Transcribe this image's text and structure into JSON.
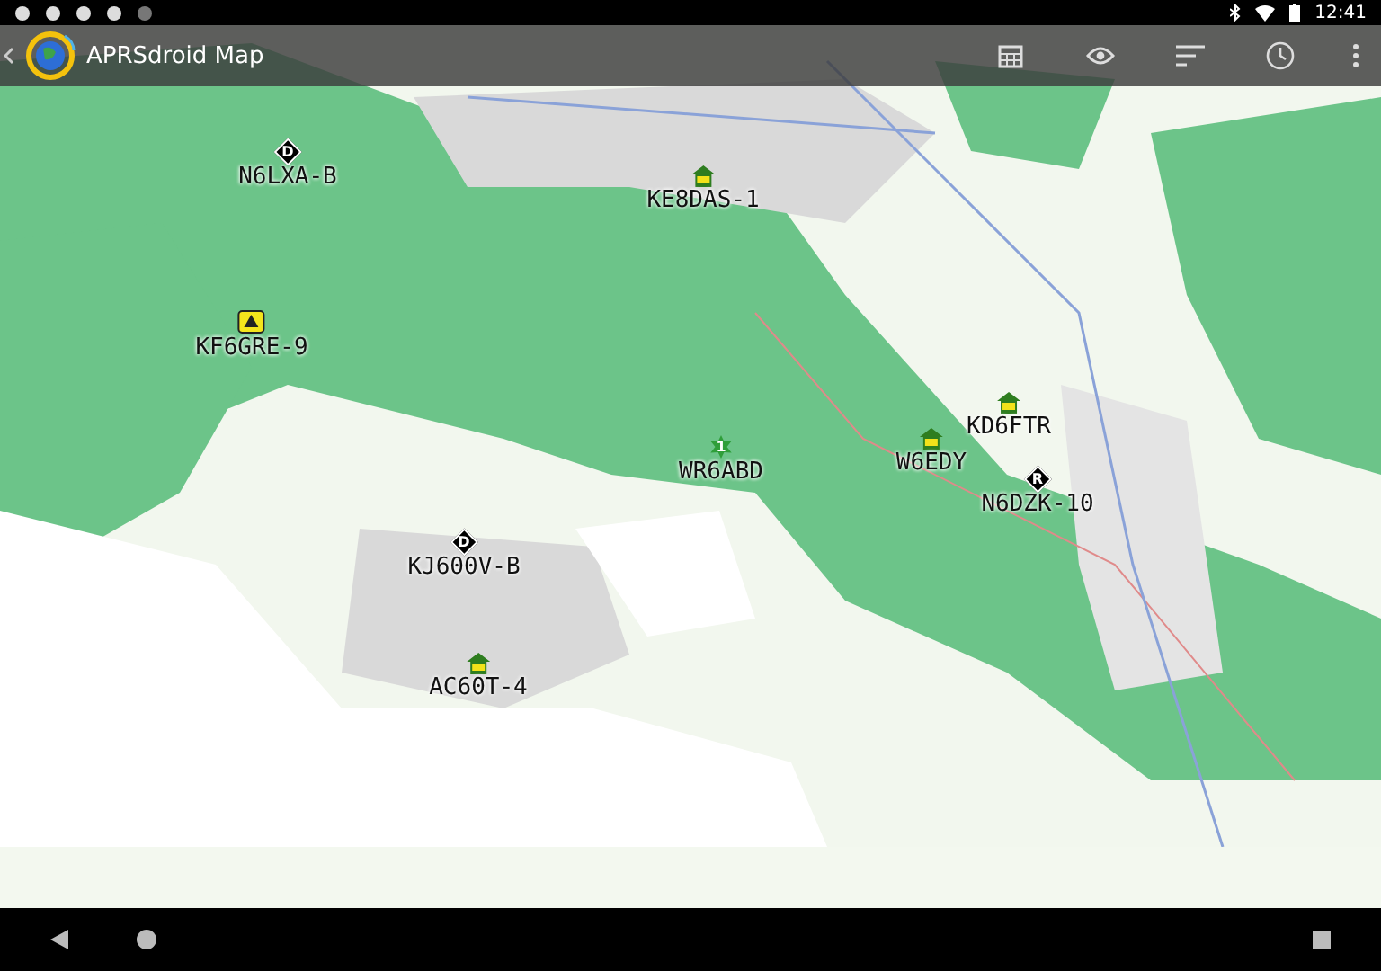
{
  "status_bar": {
    "time": "12:41"
  },
  "app_bar": {
    "title": "APRSdroid Map"
  },
  "stations": [
    {
      "callsign": "N6LXA-B",
      "kind": "diamond",
      "symbol": "D"
    },
    {
      "callsign": "KE8DAS-1",
      "kind": "house"
    },
    {
      "callsign": "KF6GRE-9",
      "kind": "vehicle"
    },
    {
      "callsign": "KD6FTR",
      "kind": "house"
    },
    {
      "callsign": "WR6ABD",
      "kind": "star",
      "symbol": "1"
    },
    {
      "callsign": "W6EDY",
      "kind": "house"
    },
    {
      "callsign": "N6DZK-10",
      "kind": "diamond",
      "symbol": "R"
    },
    {
      "callsign": "KJ600V-B",
      "kind": "diamond",
      "symbol": "D"
    },
    {
      "callsign": "AC60T-4",
      "kind": "house"
    }
  ]
}
